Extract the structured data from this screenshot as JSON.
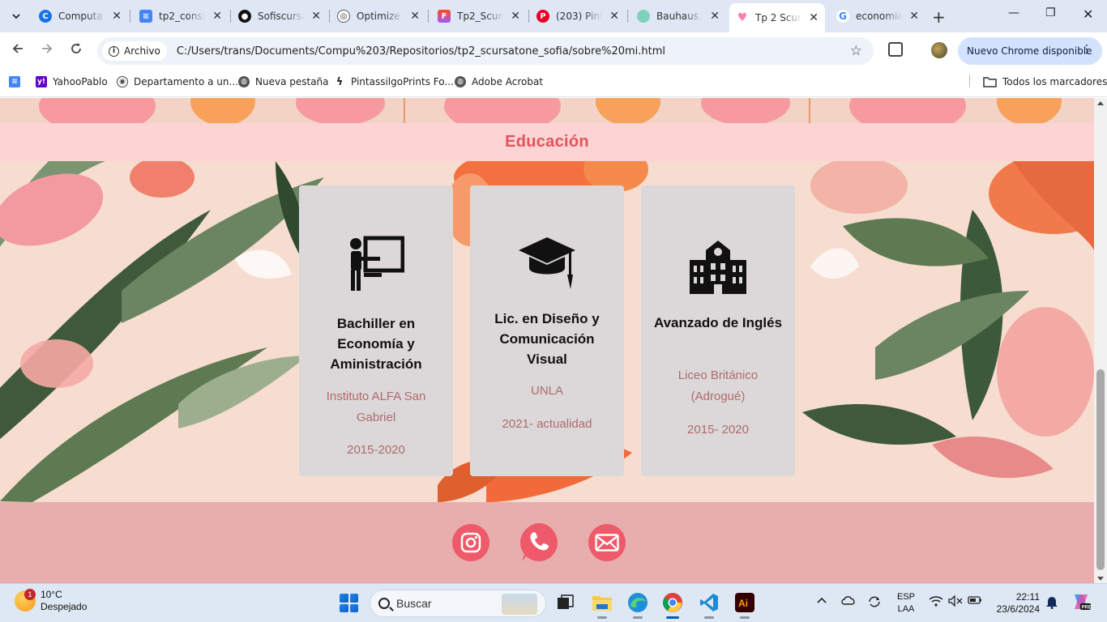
{
  "browser": {
    "tabs": [
      {
        "title": "Computa",
        "favicon_color": "#1a73e8",
        "favicon_glyph": "C"
      },
      {
        "title": "tp2_consi",
        "favicon_color": "#4285f4",
        "favicon_glyph": "≡"
      },
      {
        "title": "Sofiscursa",
        "favicon_color": "#111111",
        "favicon_glyph": "●"
      },
      {
        "title": "Optimize",
        "favicon_color": "#555555",
        "favicon_glyph": "◎"
      },
      {
        "title": "Tp2_Scurs",
        "favicon_color": "#f24e1e",
        "favicon_glyph": "F"
      },
      {
        "title": "(203) Pint",
        "favicon_color": "#e60023",
        "favicon_glyph": "P"
      },
      {
        "title": "Bauhaus,",
        "favicon_color": "#7fd1b9",
        "favicon_glyph": "●"
      },
      {
        "title": "Tp 2 Scurs",
        "favicon_color": "#ff7fb0",
        "favicon_glyph": "♥"
      },
      {
        "title": "economia",
        "favicon_color": "#4285f4",
        "favicon_glyph": "G"
      }
    ],
    "active_tab_index": 7,
    "address": {
      "chip_label": "Archivo",
      "url": "C:/Users/trans/Documents/Compu%203/Repositorios/tp2_scursatone_sofia/sobre%20mi.html"
    },
    "update_label": "Nuevo Chrome disponible",
    "bookmarks": [
      {
        "label": "",
        "icon": "docs-icon",
        "color": "#4285f4"
      },
      {
        "label": "YahooPablo",
        "icon": "yahoo-icon",
        "color": "#6001d2"
      },
      {
        "label": "Departamento a un...",
        "icon": "eye-icon",
        "color": "#444444"
      },
      {
        "label": "Nueva pestaña",
        "icon": "globe-icon",
        "color": "#555555"
      },
      {
        "label": "PintassilgoPrints Fo...",
        "icon": "bolt-icon",
        "color": "#222222"
      },
      {
        "label": "Adobe Acrobat",
        "icon": "globe-icon",
        "color": "#555555"
      }
    ],
    "all_bookmarks_label": "Todos los marcadores"
  },
  "page": {
    "section_title": "Educación",
    "cards": [
      {
        "icon": "teacher-board-icon",
        "name": "Bachiller en Economía y Aministración",
        "institution": "Instituto ALFA San Gabriel",
        "years": "2015-2020"
      },
      {
        "icon": "graduation-cap-icon",
        "name": "Lic. en Diseño y Comunicación Visual",
        "institution": "UNLA",
        "years": "2021- actualidad"
      },
      {
        "icon": "school-building-icon",
        "name": "Avanzado de Inglés",
        "institution": "Liceo Británico (Adrogué)",
        "years": "2015- 2020"
      }
    ],
    "social": [
      {
        "icon": "instagram-icon"
      },
      {
        "icon": "phone-icon"
      },
      {
        "icon": "email-icon"
      }
    ],
    "colors": {
      "section_band": "#fdd3d4",
      "title": "#e2545c",
      "card": "#dcd8d9",
      "card_subtext": "#b06a6c",
      "footer": "#e8aeae",
      "social_button": "#ef5a6a"
    }
  },
  "taskbar": {
    "weather": {
      "temp": "10°C",
      "condition": "Despejado",
      "badge": "1"
    },
    "search_placeholder": "Buscar",
    "lang_top": "ESP",
    "lang_bottom": "LAA",
    "time": "22:11",
    "date": "23/6/2024"
  }
}
